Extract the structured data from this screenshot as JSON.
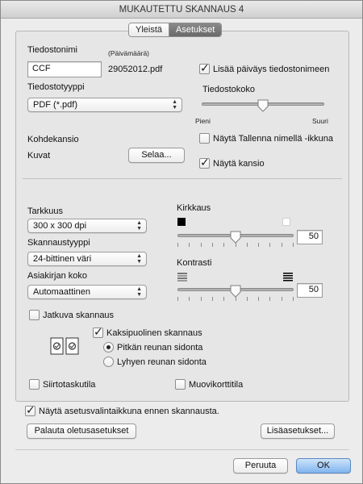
{
  "window": {
    "title": "MUKAUTETTU SKANNAUS 4"
  },
  "tabs": [
    {
      "label": "Yleistä"
    },
    {
      "label": "Asetukset"
    }
  ],
  "file": {
    "name_label": "Tiedostonimi",
    "date_label": "(Päivämäärä)",
    "name_value": "CCF",
    "date_value": "29052012.pdf",
    "add_date_label": "Lisää päiväys tiedostonimeen",
    "add_date_checked": true,
    "type_label": "Tiedostotyyppi",
    "type_value": "PDF (*.pdf)",
    "size_label": "Tiedostokoko",
    "size_min": "Pieni",
    "size_max": "Suuri",
    "size_level": 0.5,
    "dest_label": "Kohdekansio",
    "dest_value": "Kuvat",
    "browse_label": "Selaa...",
    "show_save_as_label": "Näytä Tallenna nimellä -ikkuna",
    "show_save_as_checked": false,
    "show_folder_label": "Näytä kansio",
    "show_folder_checked": true
  },
  "scan": {
    "resolution_label": "Tarkkuus",
    "resolution_value": "300 x 300 dpi",
    "scan_type_label": "Skannaustyyppi",
    "scan_type_value": "24-bittinen väri",
    "doc_size_label": "Asiakirjan koko",
    "doc_size_value": "Automaattinen",
    "brightness_label": "Kirkkaus",
    "brightness_value": "50",
    "contrast_label": "Kontrasti",
    "contrast_value": "50",
    "continuous_label": "Jatkuva skannaus",
    "continuous_checked": false,
    "duplex_label": "Kaksipuolinen skannaus",
    "duplex_checked": true,
    "long_edge_label": "Pitkän reunan sidonta",
    "long_edge_selected": true,
    "short_edge_label": "Lyhyen reunan sidonta",
    "carrier_label": "Siirtotaskutila",
    "carrier_checked": false,
    "plastic_label": "Muovikorttitila",
    "plastic_checked": false
  },
  "footer": {
    "show_dialog_label": "Näytä asetusvalintaikkuna ennen skannausta.",
    "show_dialog_checked": true,
    "restore_label": "Palauta oletusasetukset",
    "more_label": "Lisäasetukset...",
    "cancel_label": "Peruuta",
    "ok_label": "OK"
  },
  "icons": {
    "popup_arrows": "updown-arrows-icon",
    "brightness_dark": "black-square-icon",
    "brightness_light": "white-square-icon",
    "contrast_low": "low-contrast-icon",
    "contrast_high": "high-contrast-icon",
    "duplex": "duplex-pages-icon"
  }
}
